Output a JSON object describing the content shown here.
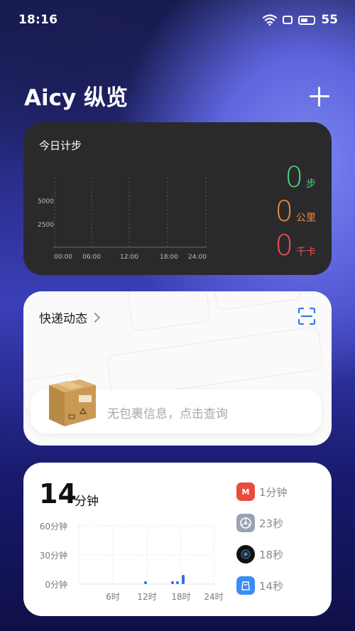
{
  "status_bar": {
    "time": "18:16",
    "battery": "55"
  },
  "header": {
    "title": "Aicy 纵览"
  },
  "steps_card": {
    "title": "今日计步",
    "chart_data": {
      "type": "line",
      "y_ticks": [
        "5000",
        "2500"
      ],
      "x_ticks": [
        "00:00",
        "06:00",
        "12:00",
        "18:00",
        "24:00"
      ],
      "values": []
    },
    "metrics": [
      {
        "value": "0",
        "unit": "步",
        "color": "#4fd07a"
      },
      {
        "value": "0",
        "unit": "公里",
        "color": "#f08a3a"
      },
      {
        "value": "0",
        "unit": "千卡",
        "color": "#ef5350"
      }
    ]
  },
  "delivery_card": {
    "title": "快递动态",
    "empty_text": "无包裹信息，点击查询"
  },
  "usage_card": {
    "total_value": "14",
    "total_unit": "分钟",
    "chart_data": {
      "type": "bar",
      "y_ticks": [
        "60分钟",
        "30分钟",
        "0分钟"
      ],
      "x_ticks": [
        "6时",
        "12时",
        "18时",
        "24时"
      ],
      "ylim": [
        0,
        60
      ]
    },
    "apps": [
      {
        "icon": "mall-app-icon",
        "color": "#e94c3d",
        "time": "1分钟"
      },
      {
        "icon": "settings-app-icon",
        "color": "#9aa3b2",
        "time": "23秒"
      },
      {
        "icon": "camera-app-icon",
        "color": "#111111",
        "time": "18秒"
      },
      {
        "icon": "app-store-icon",
        "color": "#3b8cf5",
        "time": "14秒"
      }
    ]
  }
}
